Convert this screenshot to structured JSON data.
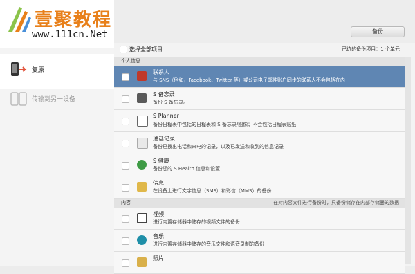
{
  "logo": {
    "title": "壹聚教程",
    "url": "www.111cn.Net"
  },
  "sidebar": {
    "items": [
      {
        "label": "复原",
        "icon": "restore-phone-icon",
        "active": true
      },
      {
        "label": "传输到另一设备",
        "icon": "transfer-device-icon",
        "active": false
      }
    ]
  },
  "toolbar": {
    "backup_label": "备份"
  },
  "selection": {
    "select_all_label": "选择全部项目",
    "selected_count": "已选的备份项目：1 个单元"
  },
  "sections": [
    {
      "title": "个人信息",
      "note": "",
      "items": [
        {
          "title": "联系人",
          "desc": "与 SNS（例如，Facebook、Twitter 等）或公司电子邮件账户同步的联系人不会包括在内",
          "icon": "contacts-icon",
          "selected": true
        },
        {
          "title": "S 备忘录",
          "desc": "备份 S 备忘录。",
          "icon": "s-memo-icon",
          "selected": false
        },
        {
          "title": "S Planner",
          "desc": "备份日程表中包括的日程表和 S 备忘录/图像；不会包括日程表贴纸",
          "icon": "calendar-icon",
          "selected": false
        },
        {
          "title": "通话记录",
          "desc": "备份已拨出电话和来电的记录，以及已发送和收到的信息记录",
          "icon": "call-log-icon",
          "selected": false
        },
        {
          "title": "S 健康",
          "desc": "备份您的 S Health 信息和设置",
          "icon": "s-health-icon",
          "selected": false
        },
        {
          "title": "信息",
          "desc": "在设备上进行文字信息（SMS）和彩信（MMS）的备份",
          "icon": "messages-icon",
          "selected": false
        }
      ]
    },
    {
      "title": "内容",
      "note": "在对内容文件进行备份时，只备份储存在内部存储器的数据",
      "items": [
        {
          "title": "视频",
          "desc": "进行内置存储器中储存的视频文件的备份",
          "icon": "video-icon",
          "selected": false
        },
        {
          "title": "音乐",
          "desc": "进行内置存储器中储存的音乐文件和语音录制的备份",
          "icon": "music-icon",
          "selected": false
        },
        {
          "title": "照片",
          "desc": "",
          "icon": "photos-icon",
          "selected": false
        }
      ]
    }
  ]
}
